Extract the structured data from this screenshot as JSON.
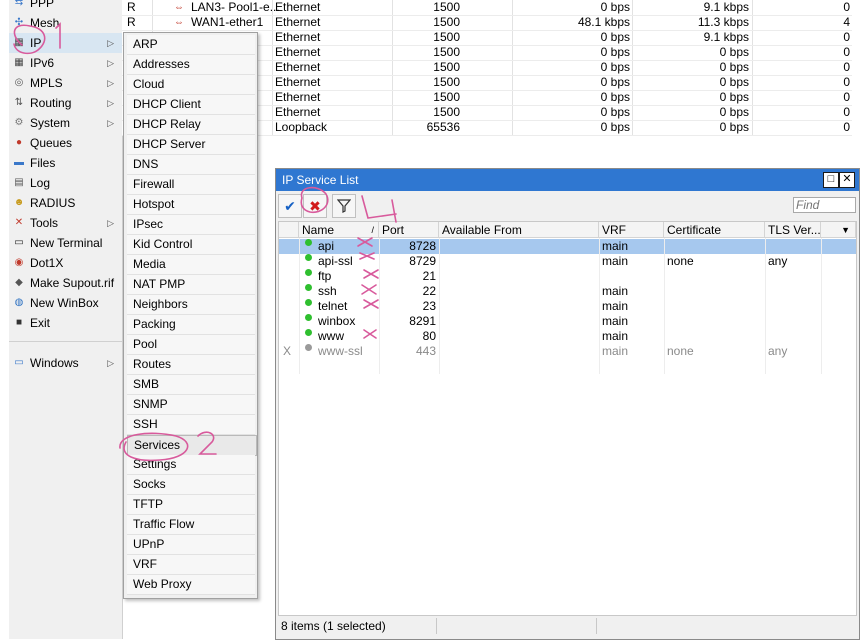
{
  "left_menu": {
    "items": [
      {
        "label": "PPP",
        "icon": "ppp-icon"
      },
      {
        "label": "Mesh",
        "icon": "mesh-icon"
      },
      {
        "label": "IP",
        "icon": "ip-icon",
        "submenu": true,
        "selected": true
      },
      {
        "label": "IPv6",
        "icon": "ipv6-icon",
        "submenu": true
      },
      {
        "label": "MPLS",
        "icon": "mpls-icon",
        "submenu": true
      },
      {
        "label": "Routing",
        "icon": "routing-icon",
        "submenu": true
      },
      {
        "label": "System",
        "icon": "gear-icon",
        "submenu": true
      },
      {
        "label": "Queues",
        "icon": "queues-icon"
      },
      {
        "label": "Files",
        "icon": "folder-icon"
      },
      {
        "label": "Log",
        "icon": "log-icon"
      },
      {
        "label": "RADIUS",
        "icon": "radius-icon"
      },
      {
        "label": "Tools",
        "icon": "tools-icon",
        "submenu": true
      },
      {
        "label": "New Terminal",
        "icon": "terminal-icon"
      },
      {
        "label": "Dot1X",
        "icon": "dot1x-icon"
      },
      {
        "label": "Make Supout.rif",
        "icon": "supout-icon"
      },
      {
        "label": "New WinBox",
        "icon": "winbox-icon"
      },
      {
        "label": "Exit",
        "icon": "exit-icon"
      },
      {
        "label": "Windows",
        "icon": "windows-icon",
        "submenu": true
      }
    ]
  },
  "ip_submenu": {
    "items": [
      "ARP",
      "Addresses",
      "Cloud",
      "DHCP Client",
      "DHCP Relay",
      "DHCP Server",
      "DNS",
      "Firewall",
      "Hotspot",
      "IPsec",
      "Kid Control",
      "Media",
      "NAT PMP",
      "Neighbors",
      "Packing",
      "Pool",
      "Routes",
      "SMB",
      "SNMP",
      "SSH",
      "Services",
      "Settings",
      "Socks",
      "TFTP",
      "Traffic Flow",
      "UPnP",
      "VRF",
      "Web Proxy"
    ],
    "highlighted": "Services"
  },
  "interface_rows": [
    {
      "flag": "R",
      "name": "LAN3- Pool1-e...",
      "type": "Ethernet",
      "mtu": "1500",
      "tx": "0 bps",
      "rx": "9.1 kbps",
      "last": "0"
    },
    {
      "flag": "R",
      "name": "WAN1-ether1",
      "type": "Ethernet",
      "mtu": "1500",
      "tx": "48.1 kbps",
      "rx": "11.3 kbps",
      "last": "4"
    },
    {
      "flag": "",
      "name": "",
      "type": "Ethernet",
      "mtu": "1500",
      "tx": "0 bps",
      "rx": "9.1 kbps",
      "last": "0"
    },
    {
      "flag": "",
      "name": "",
      "type": "Ethernet",
      "mtu": "1500",
      "tx": "0 bps",
      "rx": "0 bps",
      "last": "0"
    },
    {
      "flag": "",
      "name": "",
      "type": "Ethernet",
      "mtu": "1500",
      "tx": "0 bps",
      "rx": "0 bps",
      "last": "0"
    },
    {
      "flag": "",
      "name": "",
      "type": "Ethernet",
      "mtu": "1500",
      "tx": "0 bps",
      "rx": "0 bps",
      "last": "0"
    },
    {
      "flag": "",
      "name": "",
      "type": "Ethernet",
      "mtu": "1500",
      "tx": "0 bps",
      "rx": "0 bps",
      "last": "0"
    },
    {
      "flag": "",
      "name": "",
      "type": "Ethernet",
      "mtu": "1500",
      "tx": "0 bps",
      "rx": "0 bps",
      "last": "0"
    },
    {
      "flag": "",
      "name": "",
      "type": "Loopback",
      "mtu": "65536",
      "tx": "0 bps",
      "rx": "0 bps",
      "last": "0"
    }
  ],
  "service_window": {
    "title": "IP Service List",
    "find_placeholder": "Find",
    "columns": [
      "Name",
      "Port",
      "Available From",
      "VRF",
      "Certificate",
      "TLS Ver..."
    ],
    "sort_marker": "/",
    "rows": [
      {
        "flag": "",
        "name": "api",
        "port": "8728",
        "available_from": "",
        "vrf": "main",
        "certificate": "",
        "tls": "",
        "status": "enabled",
        "selected": true
      },
      {
        "flag": "",
        "name": "api-ssl",
        "port": "8729",
        "available_from": "",
        "vrf": "main",
        "certificate": "none",
        "tls": "any",
        "status": "enabled"
      },
      {
        "flag": "",
        "name": "ftp",
        "port": "21",
        "available_from": "",
        "vrf": "",
        "certificate": "",
        "tls": "",
        "status": "enabled"
      },
      {
        "flag": "",
        "name": "ssh",
        "port": "22",
        "available_from": "",
        "vrf": "main",
        "certificate": "",
        "tls": "",
        "status": "enabled"
      },
      {
        "flag": "",
        "name": "telnet",
        "port": "23",
        "available_from": "",
        "vrf": "main",
        "certificate": "",
        "tls": "",
        "status": "enabled"
      },
      {
        "flag": "",
        "name": "winbox",
        "port": "8291",
        "available_from": "",
        "vrf": "main",
        "certificate": "",
        "tls": "",
        "status": "enabled"
      },
      {
        "flag": "",
        "name": "www",
        "port": "80",
        "available_from": "",
        "vrf": "main",
        "certificate": "",
        "tls": "",
        "status": "enabled"
      },
      {
        "flag": "X",
        "name": "www-ssl",
        "port": "443",
        "available_from": "",
        "vrf": "main",
        "certificate": "none",
        "tls": "any",
        "status": "disabled"
      }
    ],
    "status_text": "8 items (1 selected)"
  },
  "annotations": {
    "number_1": "1",
    "number_2": "2",
    "number_4": "4"
  },
  "colors": {
    "titlebar": "#2f77d1",
    "selection": "#a6c8ee",
    "enabled_dot": "#2fbf2f",
    "disabled_dot": "#9a9a9a",
    "pen": "#d85a9c"
  }
}
